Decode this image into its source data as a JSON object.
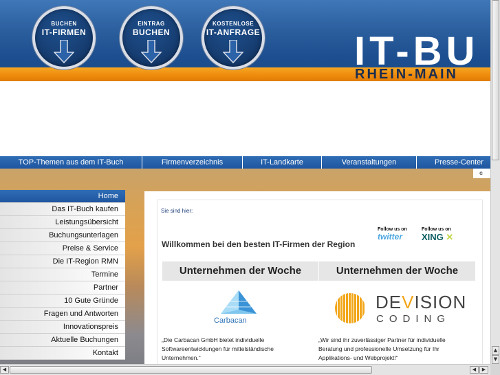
{
  "header": {
    "buttons": [
      {
        "small": "BUCHEN",
        "big": "IT-FIRMEN"
      },
      {
        "small": "EINTRAG",
        "big": "BUCHEN"
      },
      {
        "small": "KOSTENLOSE",
        "big": "IT-ANFRAGE"
      }
    ],
    "brand_title": "IT-BU",
    "brand_subtitle": "RHEIN-MAIN"
  },
  "topnav": [
    "TOP-Themen aus dem IT-Buch",
    "Firmenverzeichnis",
    "IT-Landkarte",
    "Veranstaltungen",
    "Presse-Center"
  ],
  "corner_tab": "e",
  "sidebar": [
    "Home",
    "Das IT-Buch kaufen",
    "Leistungsübersicht",
    "Buchungsunterlagen",
    "Preise & Service",
    "Die IT-Region RMN",
    "Termine",
    "Partner",
    "10 Gute Gründe",
    "Fragen und Antworten",
    "Innovationspreis",
    "Aktuelle Buchungen",
    "Kontakt"
  ],
  "main": {
    "breadcrumb": "Sie sind hier:",
    "welcome": "Willkommen bei den besten IT-Firmen der Region",
    "social": {
      "twitter_label": "Follow us on",
      "twitter_brand": "twitter",
      "xing_label": "Follow us on",
      "xing_brand": "XING"
    },
    "week_header_1": "Unternehmen der Woche",
    "week_header_2": "Unternehmen der Woche",
    "company_1": {
      "logo_text": "Carbacan",
      "description": "„Die Carbacan GmbH bietet individuelle Softwareentwicklungen für mittelständische Unternehmen.“"
    },
    "company_2": {
      "logo_de": "DE",
      "logo_v": "V",
      "logo_ision": "ISION",
      "logo_coding": "CODING",
      "description": "„Wir sind ihr zuverlässiger Partner für individuelle Beratung und professionelle Umsetzung für Ihr Applikations- und Webprojekt!“"
    }
  },
  "colors": {
    "nav_blue": "#1f56a0",
    "header_orange": "#ee8a0c",
    "devision_orange": "#f2a61a",
    "carbacan_blue": "#2f73b8"
  }
}
